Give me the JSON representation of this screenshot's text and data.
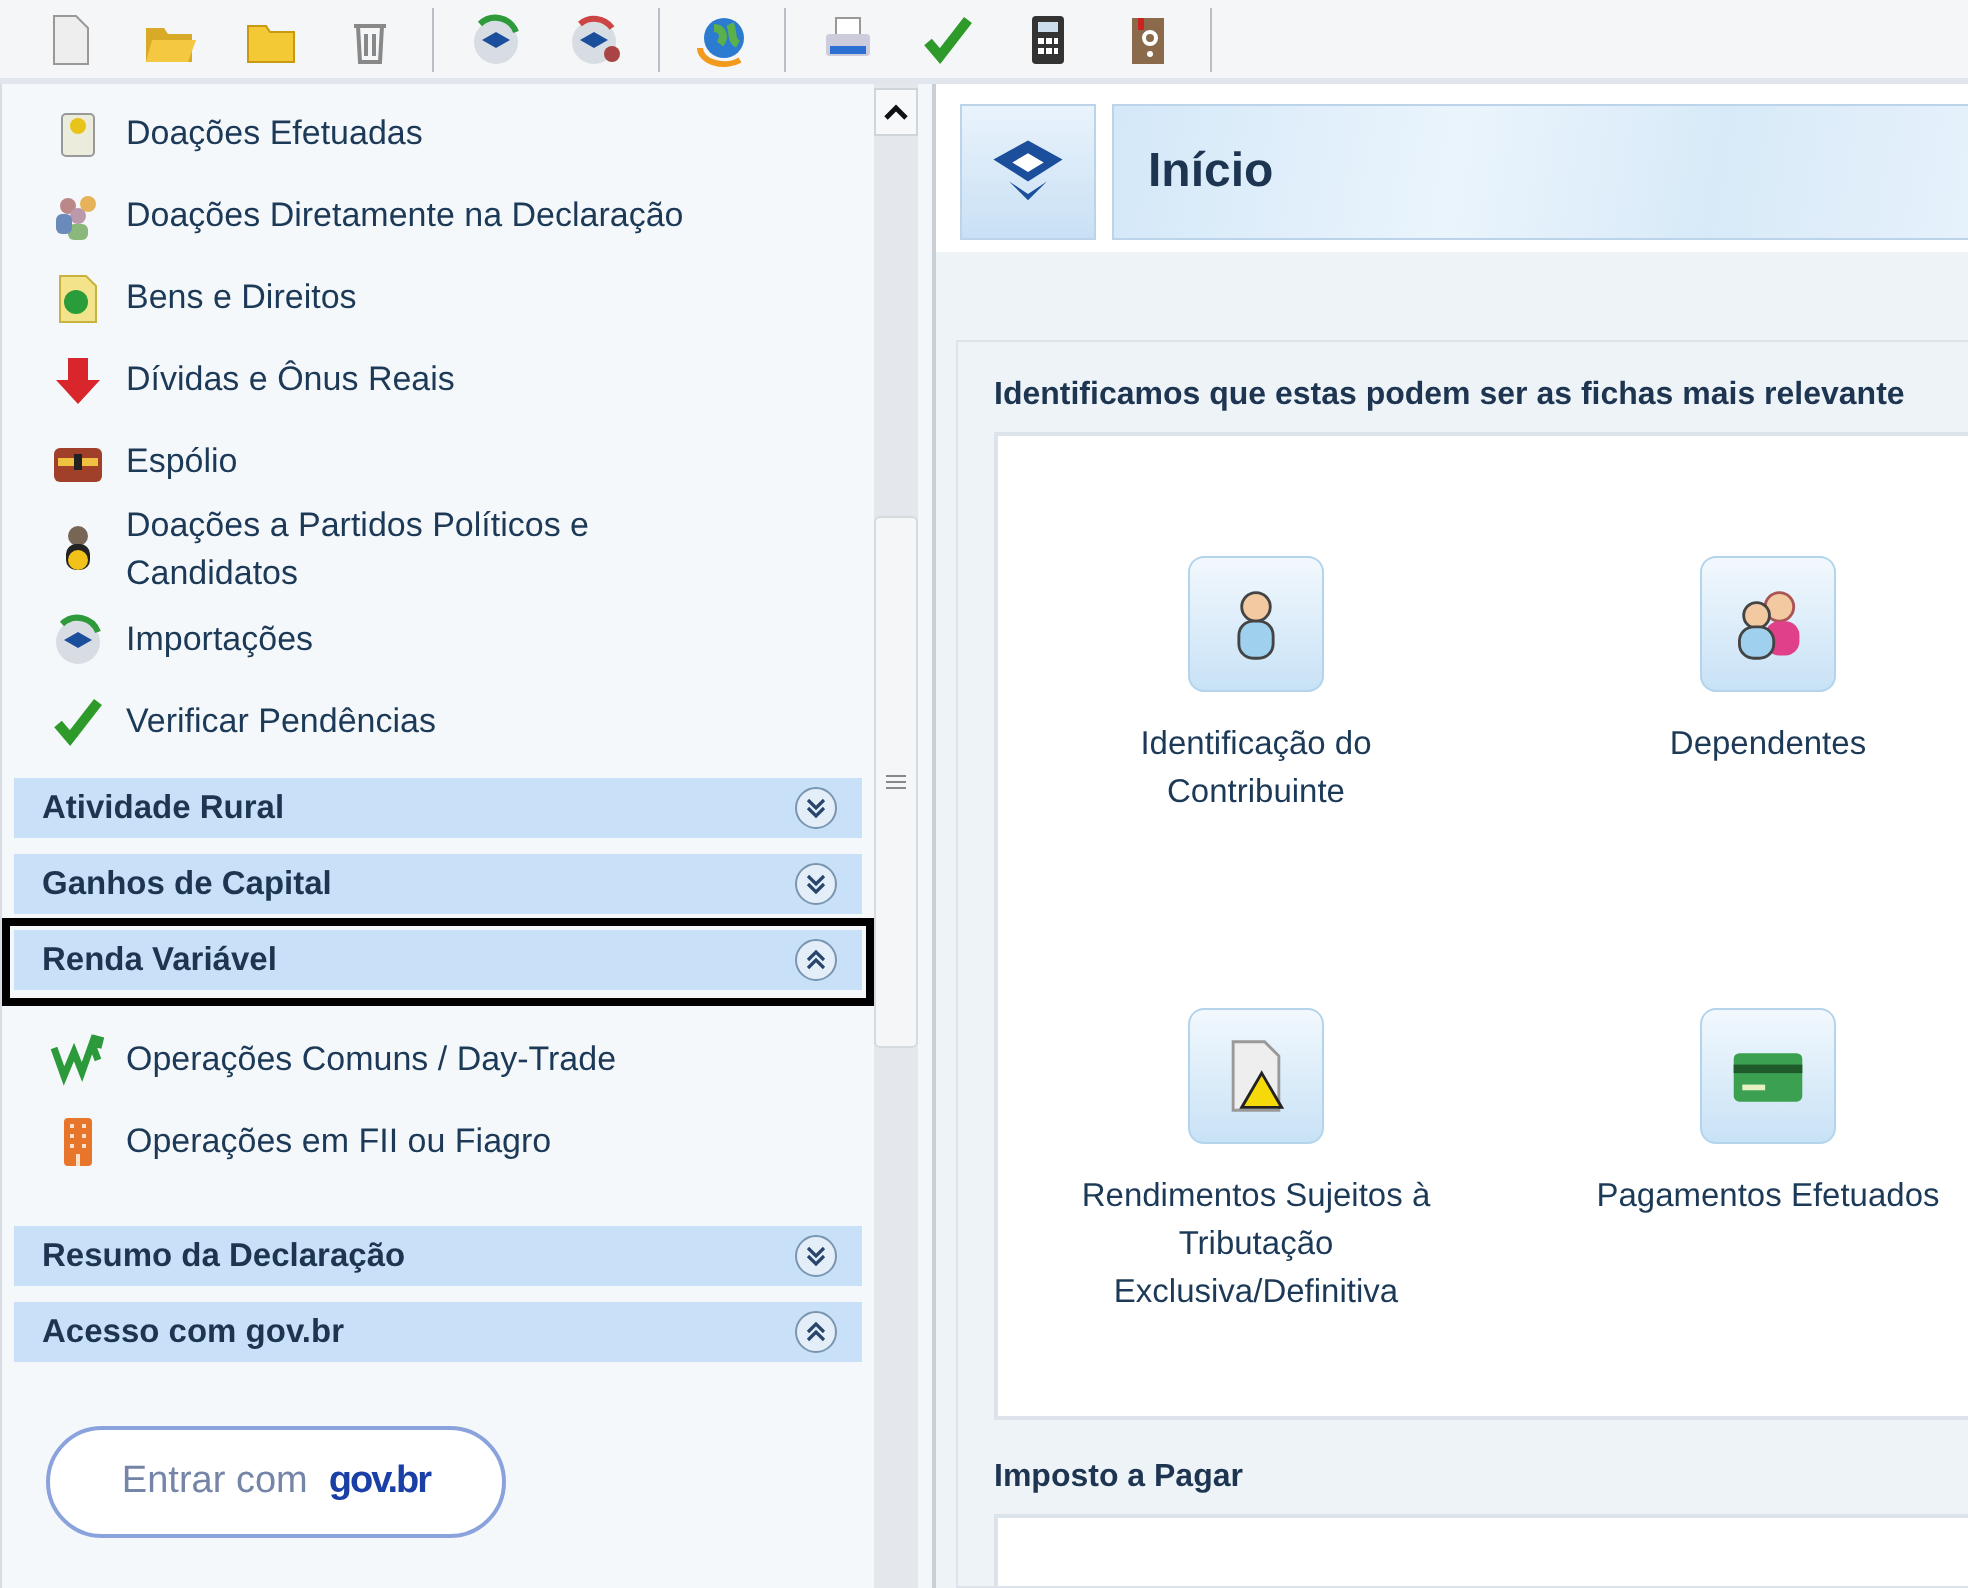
{
  "toolbar": {
    "buttons": [
      {
        "kind": "new"
      },
      {
        "kind": "open"
      },
      {
        "kind": "folder"
      },
      {
        "kind": "delete"
      },
      {
        "kind": "separator"
      },
      {
        "kind": "sync"
      },
      {
        "kind": "sync-person"
      },
      {
        "kind": "separator"
      },
      {
        "kind": "globe"
      },
      {
        "kind": "separator"
      },
      {
        "kind": "print"
      },
      {
        "kind": "check"
      },
      {
        "kind": "calc"
      },
      {
        "kind": "help"
      }
    ]
  },
  "sidebar": {
    "items": [
      {
        "label": "Doações Efetuadas"
      },
      {
        "label": "Doações Diretamente na Declaração"
      },
      {
        "label": "Bens e Direitos"
      },
      {
        "label": "Dívidas e Ônus Reais"
      },
      {
        "label": "Espólio"
      },
      {
        "label": "Doações a Partidos Políticos e Candidatos"
      },
      {
        "label": "Importações"
      },
      {
        "label": "Verificar Pendências"
      }
    ],
    "sections": [
      {
        "title": "Atividade Rural",
        "expanded": false,
        "highlighted": false
      },
      {
        "title": "Ganhos de Capital",
        "expanded": false,
        "highlighted": false
      },
      {
        "title": "Renda Variável",
        "expanded": true,
        "highlighted": true,
        "children": [
          {
            "label": "Operações Comuns / Day-Trade"
          },
          {
            "label": "Operações em FII ou Fiagro"
          }
        ]
      },
      {
        "title": "Resumo da Declaração",
        "expanded": false,
        "highlighted": false
      },
      {
        "title": "Acesso com gov.br",
        "expanded": true,
        "highlighted": false
      }
    ],
    "login_button": "Entrar com  **gov.br**"
  },
  "main": {
    "title": "Início",
    "relevant_heading": "Identificamos que estas podem ser as fichas mais relevante",
    "cards": [
      {
        "label": "Identificação do Contribuinte"
      },
      {
        "label": "Dependentes"
      },
      {
        "label": "Rendimentos Sujeitos à Tributação Exclusiva/Definitiva"
      },
      {
        "label": "Pagamentos Efetuados"
      }
    ],
    "tax_heading": "Imposto a Pagar"
  }
}
